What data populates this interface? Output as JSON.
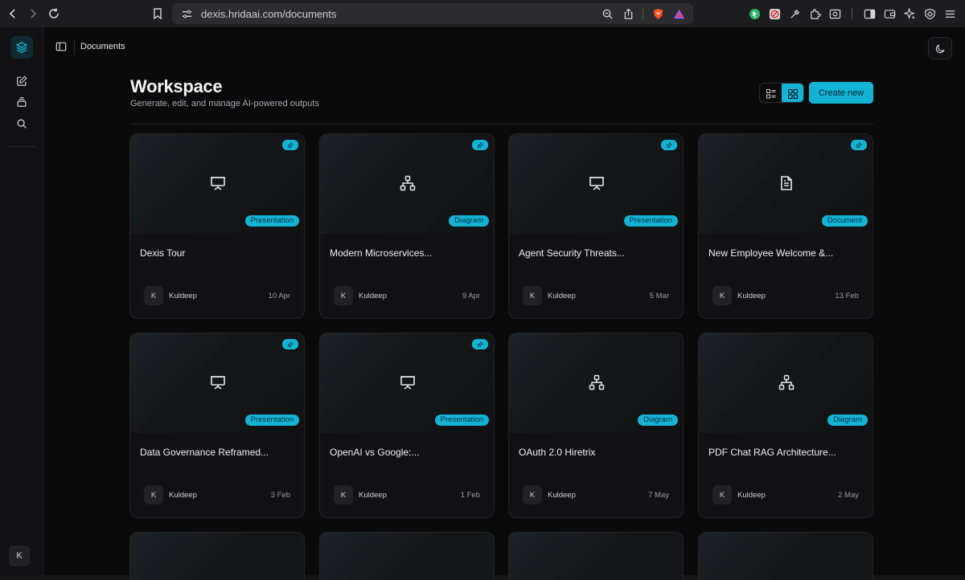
{
  "browser": {
    "url": "dexis.hridaai.com/documents"
  },
  "topbar": {
    "breadcrumb": "Documents"
  },
  "header": {
    "title": "Workspace",
    "subtitle": "Generate, edit, and manage AI-powered outputs",
    "create_label": "Create new"
  },
  "rail": {
    "avatar_initial": "K"
  },
  "accent_color": "#14b3d4",
  "cards": [
    {
      "title": "Dexis Tour",
      "type": "Presentation",
      "icon": "presentation-icon",
      "author_initial": "K",
      "author": "Kuldeep",
      "date": "10 Apr",
      "pinned": true
    },
    {
      "title": "Modern Microservices...",
      "type": "Diagram",
      "icon": "diagram-icon",
      "author_initial": "K",
      "author": "Kuldeep",
      "date": "9 Apr",
      "pinned": true
    },
    {
      "title": "Agent Security Threats...",
      "type": "Presentation",
      "icon": "presentation-icon",
      "author_initial": "K",
      "author": "Kuldeep",
      "date": "5 Mar",
      "pinned": true
    },
    {
      "title": "New Employee Welcome &...",
      "type": "Document",
      "icon": "document-icon",
      "author_initial": "K",
      "author": "Kuldeep",
      "date": "13 Feb",
      "pinned": true
    },
    {
      "title": "Data Governance Reframed...",
      "type": "Presentation",
      "icon": "presentation-icon",
      "author_initial": "K",
      "author": "Kuldeep",
      "date": "3 Feb",
      "pinned": true
    },
    {
      "title": "OpenAI vs Google:...",
      "type": "Presentation",
      "icon": "presentation-icon",
      "author_initial": "K",
      "author": "Kuldeep",
      "date": "1 Feb",
      "pinned": true
    },
    {
      "title": "OAuth 2.0 Hiretrix",
      "type": "Diagram",
      "icon": "diagram-icon",
      "author_initial": "K",
      "author": "Kuldeep",
      "date": "7 May",
      "pinned": false
    },
    {
      "title": "PDF Chat RAG Architecture...",
      "type": "Diagram",
      "icon": "diagram-icon",
      "author_initial": "K",
      "author": "Kuldeep",
      "date": "2 May",
      "pinned": false
    }
  ]
}
